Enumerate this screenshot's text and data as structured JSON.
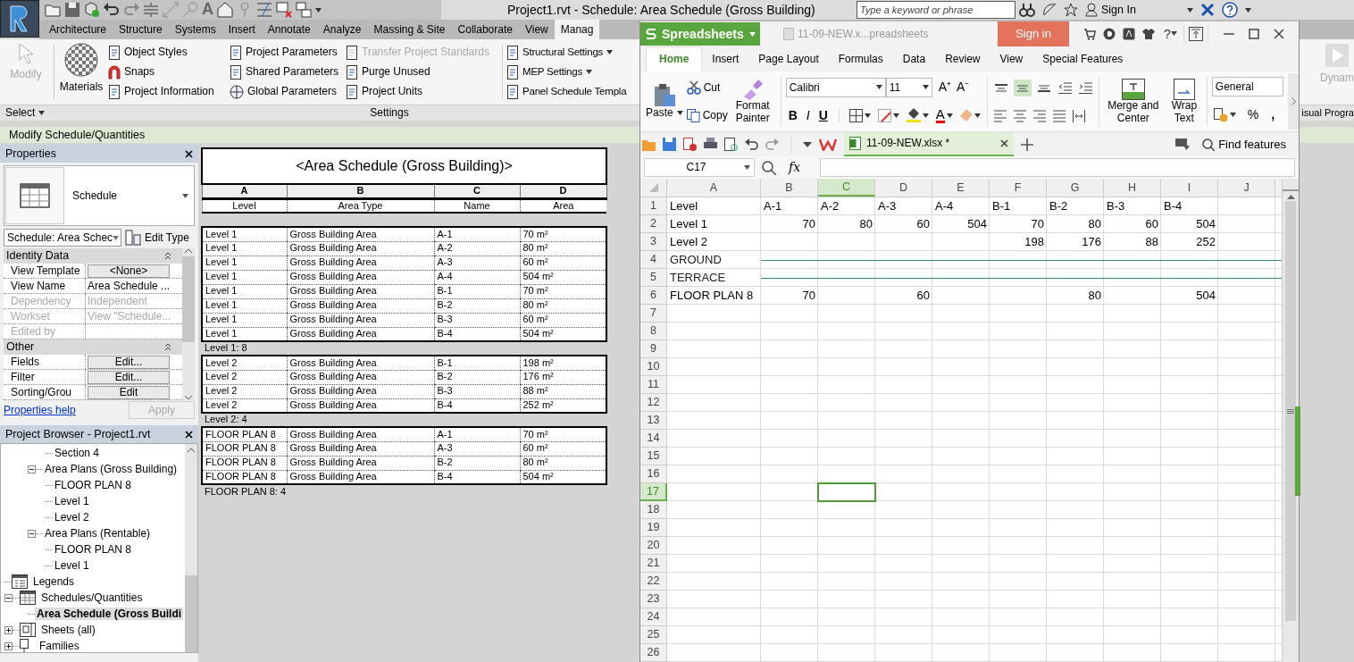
{
  "title_bar": {
    "text_tool": "A",
    "title": "Project1.rvt - Schedule: Area Schedule (Gross Building)",
    "search": {
      "placeholder": "Type a keyword or phrase"
    },
    "sign_in": "Sign In"
  },
  "ribbon": {
    "tabs": [
      {
        "label": "Architecture",
        "selected": false
      },
      {
        "label": "Structure",
        "selected": false
      },
      {
        "label": "Systems",
        "selected": false
      },
      {
        "label": "Insert",
        "selected": false
      },
      {
        "label": "Annotate",
        "selected": false
      },
      {
        "label": "Analyze",
        "selected": false
      },
      {
        "label": "Massing & Site",
        "selected": false
      },
      {
        "label": "Collaborate",
        "selected": false
      },
      {
        "label": "View",
        "selected": false
      },
      {
        "label": "Manag",
        "selected": true
      }
    ],
    "select_panel": {
      "label": "Select",
      "tool": {
        "label": "Modify",
        "disabled": true
      }
    },
    "settings_panel": {
      "label": "Settings",
      "large_tool": {
        "label": "Materials",
        "disabled": false
      },
      "columns": [
        [
          {
            "label": "Object Styles",
            "disabled": false
          },
          {
            "label": "Snaps",
            "kind": "magnet",
            "disabled": false
          },
          {
            "label": "Project Information",
            "disabled": false
          }
        ],
        [
          {
            "label": "Project Parameters",
            "disabled": false
          },
          {
            "label": "Shared Parameters",
            "disabled": false
          },
          {
            "label": "Global Parameters",
            "kind": "globe",
            "disabled": false
          }
        ],
        [
          {
            "label": "Transfer Project Standards",
            "disabled": true
          },
          {
            "label": "Purge Unused",
            "disabled": false
          },
          {
            "label": "Project Units",
            "disabled": false
          }
        ],
        [
          {
            "label": "Structural Settings",
            "dropdown": true,
            "disabled": false
          },
          {
            "label": "MEP Settings",
            "dropdown": true,
            "disabled": false
          },
          {
            "label": "Panel Schedule Templa",
            "disabled": false
          }
        ]
      ]
    },
    "right_tool": {
      "label": "Dynam",
      "disabled": true
    },
    "right_panel_label": "isual Progra"
  },
  "context_bar": "Modify Schedule/Quantities",
  "properties": {
    "title": "Properties",
    "type": "Schedule",
    "instance": "Schedule: Area Schec",
    "edit_type": "Edit Type",
    "sections": [
      {
        "label": "Identity Data",
        "expanded": true,
        "rows": [
          {
            "label": "View Template",
            "value": "<None>",
            "kind": "button",
            "disabled": false
          },
          {
            "label": "View Name",
            "value": "Area Schedule ...",
            "kind": "text",
            "disabled": false
          },
          {
            "label": "Dependency",
            "value": "Independent",
            "kind": "text",
            "disabled": true
          },
          {
            "label": "Workset",
            "value": "View \"Schedule...",
            "kind": "text",
            "disabled": true
          },
          {
            "label": "Edited by",
            "disabled": true
          }
        ]
      },
      {
        "label": "Other",
        "expanded": true,
        "rows": [
          {
            "label": "Fields",
            "value": "Edit...",
            "kind": "button",
            "disabled": false
          },
          {
            "label": "Filter",
            "value": "Edit...",
            "kind": "button",
            "disabled": false
          },
          {
            "label": "Sorting/Grou",
            "value": "Edit",
            "kind": "button",
            "disabled": false
          }
        ]
      }
    ],
    "help_link": "Properties help",
    "apply": {
      "label": "Apply",
      "disabled": true
    }
  },
  "project_browser": {
    "title": "Project Browser - Project1.rvt",
    "tree": [
      {
        "children": [
          {
            "children": [
              {
                "label": "Section 4",
                "selected": false
              }
            ]
          },
          {
            "label": "Area Plans (Gross Building)",
            "expanded": true,
            "selected": false,
            "children": [
              {
                "label": "FLOOR PLAN 8",
                "selected": false
              },
              {
                "label": "Level 1",
                "selected": false
              },
              {
                "label": "Level 2",
                "selected": false
              }
            ]
          },
          {
            "label": "Area Plans (Rentable)",
            "expanded": true,
            "selected": false,
            "children": [
              {
                "label": "FLOOR PLAN 8",
                "selected": false
              },
              {
                "label": "Level 1",
                "selected": false
              }
            ]
          }
        ]
      },
      {
        "label": "Legends",
        "kind": "legends",
        "selected": false
      },
      {
        "label": "Schedules/Quantities",
        "kind": "schedules",
        "expanded": true,
        "selected": false,
        "children": [
          {
            "label": "Area Schedule (Gross Buildi",
            "selected": true
          }
        ]
      },
      {
        "label": "Sheets (all)",
        "kind": "sheets",
        "expanded": false,
        "selected": false
      },
      {
        "label": "Families",
        "kind": "families",
        "expanded": false,
        "selected": false
      }
    ]
  },
  "schedule": {
    "title": "<Area Schedule (Gross Building)>",
    "column_letters": [
      "A",
      "B",
      "C",
      "D"
    ],
    "headings": [
      "Level",
      "Area Type",
      "Name",
      "Area"
    ],
    "groups": [
      {
        "rows": [
          [
            "Level 1",
            "Gross Building Area",
            "A-1",
            "70 m²"
          ],
          [
            "Level 1",
            "Gross Building Area",
            "A-2",
            "80 m²"
          ],
          [
            "Level 1",
            "Gross Building Area",
            "A-3",
            "60 m²"
          ],
          [
            "Level 1",
            "Gross Building Area",
            "A-4",
            "504 m²"
          ],
          [
            "Level 1",
            "Gross Building Area",
            "B-1",
            "70 m²"
          ],
          [
            "Level 1",
            "Gross Building Area",
            "B-2",
            "80 m²"
          ],
          [
            "Level 1",
            "Gross Building Area",
            "B-3",
            "60 m²"
          ],
          [
            "Level 1",
            "Gross Building Area",
            "B-4",
            "504 m²"
          ]
        ],
        "footer": "Level 1: 8"
      },
      {
        "rows": [
          [
            "Level 2",
            "Gross Building Area",
            "B-1",
            "198 m²"
          ],
          [
            "Level 2",
            "Gross Building Area",
            "B-2",
            "176 m²"
          ],
          [
            "Level 2",
            "Gross Building Area",
            "B-3",
            "88 m²"
          ],
          [
            "Level 2",
            "Gross Building Area",
            "B-4",
            "252 m²"
          ]
        ],
        "footer": "Level 2: 4"
      },
      {
        "rows": [
          [
            "FLOOR PLAN 8",
            "Gross Building Area",
            "A-1",
            "70 m²"
          ],
          [
            "FLOOR PLAN 8",
            "Gross Building Area",
            "A-3",
            "60 m²"
          ],
          [
            "FLOOR PLAN 8",
            "Gross Building Area",
            "B-2",
            "80 m²"
          ],
          [
            "FLOOR PLAN 8",
            "Gross Building Area",
            "B-4",
            "504 m²"
          ]
        ],
        "footer": "FLOOR PLAN 8: 4"
      }
    ]
  },
  "spreadsheet": {
    "app_button": "Spreadsheets",
    "document_title": "11-09-NEW.x...preadsheets",
    "sign_in": "Sign in",
    "help": "?",
    "tabs": [
      {
        "label": "Home",
        "selected": true
      },
      {
        "label": "Insert",
        "selected": false
      },
      {
        "label": "Page Layout",
        "selected": false
      },
      {
        "label": "Formulas",
        "selected": false
      },
      {
        "label": "Data",
        "selected": false
      },
      {
        "label": "Review",
        "selected": false
      },
      {
        "label": "View",
        "selected": false
      },
      {
        "label": "Special Features",
        "selected": false
      }
    ],
    "toolbar": {
      "paste": "Paste",
      "cut": "Cut",
      "copy": "Copy",
      "format_painter": "Format Painter",
      "font": "Calibri",
      "font_size": "11",
      "grow_font": "A⁺",
      "shrink_font": "A⁻",
      "bold": "B",
      "italic": "I",
      "underline": "U",
      "font_color": "A",
      "vertical_align": [
        {
          "kind": "top",
          "selected": false
        },
        {
          "kind": "middle",
          "selected": true
        },
        {
          "kind": "bottom",
          "selected": false
        }
      ],
      "merge": "Merge and Center",
      "wrap": "Wrap Text",
      "number_format": "General",
      "percent": "%",
      "comma": ","
    },
    "file_tab": "11-09-NEW.xlsx *",
    "find": "Find features",
    "name_box": "C17",
    "fx": "fx",
    "columns": [
      {
        "label": "A",
        "selected": false
      },
      {
        "label": "B",
        "selected": false
      },
      {
        "label": "C",
        "selected": true
      },
      {
        "label": "D",
        "selected": false
      },
      {
        "label": "E",
        "selected": false
      },
      {
        "label": "F",
        "selected": false
      },
      {
        "label": "G",
        "selected": false
      },
      {
        "label": "H",
        "selected": false
      },
      {
        "label": "I",
        "selected": false
      },
      {
        "label": "J",
        "selected": false
      }
    ],
    "rows": [
      {
        "number": "1",
        "selected": false,
        "struck": false,
        "cells": [
          "Level",
          "A-1",
          "A-2",
          "A-3",
          "A-4",
          "B-1",
          "B-2",
          "B-3",
          "B-4"
        ]
      },
      {
        "number": "2",
        "selected": false,
        "struck": false,
        "cells": [
          "Level 1",
          "70",
          "80",
          "60",
          "504",
          "70",
          "80",
          "60",
          "504"
        ]
      },
      {
        "number": "3",
        "selected": false,
        "struck": false,
        "cells": [
          "Level 2",
          null,
          null,
          null,
          null,
          "198",
          "176",
          "88",
          "252"
        ]
      },
      {
        "number": "4",
        "selected": false,
        "struck": true,
        "cells": [
          "GROUND"
        ]
      },
      {
        "number": "5",
        "selected": false,
        "struck": true,
        "cells": [
          "TERRACE"
        ]
      },
      {
        "number": "6",
        "selected": false,
        "struck": false,
        "cells": [
          "FLOOR PLAN 8",
          "70",
          null,
          "60",
          null,
          null,
          "80",
          null,
          "504"
        ]
      },
      {
        "number": "7",
        "selected": false,
        "struck": false
      },
      {
        "number": "8",
        "selected": false,
        "struck": false
      },
      {
        "number": "9",
        "selected": false,
        "struck": false
      },
      {
        "number": "10",
        "selected": false,
        "struck": false
      },
      {
        "number": "11",
        "selected": false,
        "struck": false
      },
      {
        "number": "12",
        "selected": false,
        "struck": false
      },
      {
        "number": "13",
        "selected": false,
        "struck": false
      },
      {
        "number": "14",
        "selected": false,
        "struck": false
      },
      {
        "number": "15",
        "selected": false,
        "struck": false
      },
      {
        "number": "16",
        "selected": false,
        "struck": false
      },
      {
        "number": "17",
        "selected": true,
        "struck": false
      },
      {
        "number": "18",
        "selected": false,
        "struck": false
      },
      {
        "number": "19",
        "selected": false,
        "struck": false
      },
      {
        "number": "20",
        "selected": false,
        "struck": false
      },
      {
        "number": "21",
        "selected": false,
        "struck": false
      },
      {
        "number": "22",
        "selected": false,
        "struck": false
      },
      {
        "number": "23",
        "selected": false,
        "struck": false
      },
      {
        "number": "24",
        "selected": false,
        "struck": false
      },
      {
        "number": "25",
        "selected": false,
        "struck": false
      },
      {
        "number": "26",
        "selected": false,
        "struck": false
      }
    ]
  }
}
